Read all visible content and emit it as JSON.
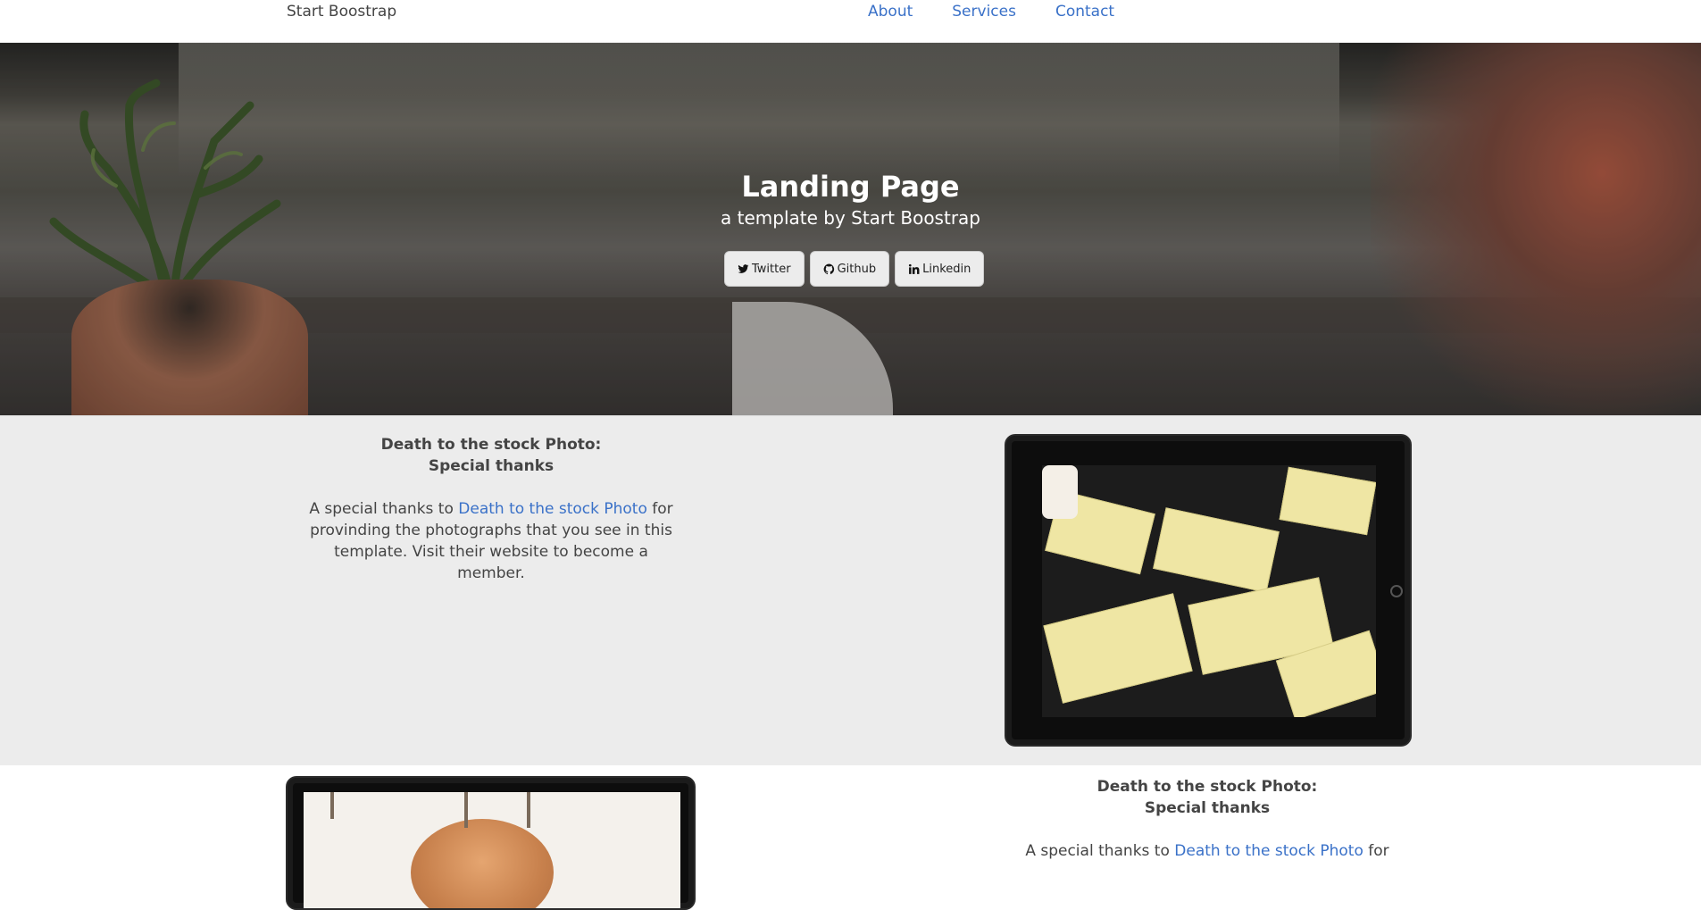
{
  "nav": {
    "brand": "Start Boostrap",
    "links": [
      "About",
      "Services",
      "Contact"
    ]
  },
  "hero": {
    "title": "Landing Page",
    "subtitle": "a template by Start Boostrap",
    "buttons": [
      {
        "label": "Twitter",
        "icon": "twitter-icon"
      },
      {
        "label": "Github",
        "icon": "github-icon"
      },
      {
        "label": "Linkedin",
        "icon": "linkedin-icon"
      }
    ]
  },
  "features": [
    {
      "heading_line1": "Death to the stock Photo:",
      "heading_line2": "Special thanks",
      "body_pre": "A special thanks to ",
      "link": "Death to the stock Photo",
      "body_post": " for provinding the photographs that you see in this template. Visit their website to become a member."
    },
    {
      "heading_line1": "Death to the stock Photo:",
      "heading_line2": "Special thanks",
      "body_pre": "A special thanks to ",
      "link": "Death to the stock Photo",
      "body_post": " for"
    }
  ],
  "colors": {
    "link": "#3a71c8",
    "section_gray": "#ececec",
    "text": "#444444"
  }
}
